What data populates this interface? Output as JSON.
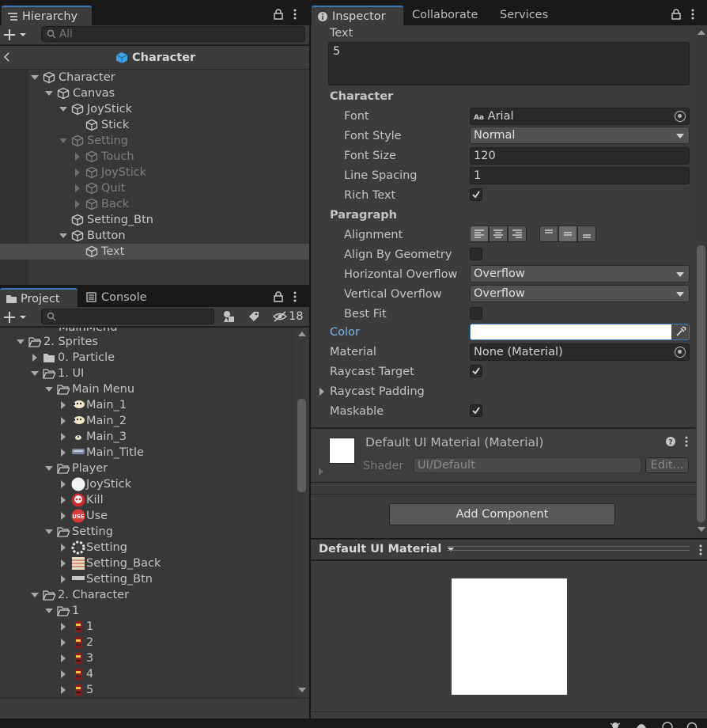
{
  "hierarchy": {
    "tab_label": "Hierarchy",
    "search_placeholder": "All",
    "scene_title": "Character",
    "rows": [
      {
        "label": "Character",
        "indent": 0,
        "arrow": "down",
        "dim": false
      },
      {
        "label": "Canvas",
        "indent": 1,
        "arrow": "down",
        "dim": false
      },
      {
        "label": "JoyStick",
        "indent": 2,
        "arrow": "down",
        "dim": false
      },
      {
        "label": "Stick",
        "indent": 3,
        "arrow": "",
        "dim": false
      },
      {
        "label": "Setting",
        "indent": 2,
        "arrow": "down",
        "dim": true
      },
      {
        "label": "Touch",
        "indent": 3,
        "arrow": "right",
        "dim": true
      },
      {
        "label": "JoyStick",
        "indent": 3,
        "arrow": "right",
        "dim": true
      },
      {
        "label": "Quit",
        "indent": 3,
        "arrow": "right",
        "dim": true
      },
      {
        "label": "Back",
        "indent": 3,
        "arrow": "right",
        "dim": true
      },
      {
        "label": "Setting_Btn",
        "indent": 2,
        "arrow": "",
        "dim": false
      },
      {
        "label": "Button",
        "indent": 2,
        "arrow": "down",
        "dim": false
      },
      {
        "label": "Text",
        "indent": 3,
        "arrow": "",
        "dim": false,
        "selected": true
      }
    ]
  },
  "project": {
    "tab_project": "Project",
    "tab_console": "Console",
    "hidden_count": "18",
    "partial_top": "MainMenu",
    "rows": [
      {
        "label": "2. Sprites",
        "indent": 0,
        "arrow": "down",
        "icon": "folder-open"
      },
      {
        "label": "0. Particle",
        "indent": 1,
        "arrow": "right",
        "icon": "folder"
      },
      {
        "label": "1. UI",
        "indent": 1,
        "arrow": "down",
        "icon": "folder-open"
      },
      {
        "label": "Main Menu",
        "indent": 2,
        "arrow": "down",
        "icon": "folder-open"
      },
      {
        "label": "Main_1",
        "indent": 3,
        "arrow": "right",
        "icon": "sprite-face"
      },
      {
        "label": "Main_2",
        "indent": 3,
        "arrow": "right",
        "icon": "sprite-face"
      },
      {
        "label": "Main_3",
        "indent": 3,
        "arrow": "right",
        "icon": "sprite-small"
      },
      {
        "label": "Main_Title",
        "indent": 3,
        "arrow": "right",
        "icon": "sprite-title"
      },
      {
        "label": "Player",
        "indent": 2,
        "arrow": "down",
        "icon": "folder-open"
      },
      {
        "label": "JoyStick",
        "indent": 3,
        "arrow": "right",
        "icon": "sprite-circle"
      },
      {
        "label": "Kill",
        "indent": 3,
        "arrow": "right",
        "icon": "sprite-skull"
      },
      {
        "label": "Use",
        "indent": 3,
        "arrow": "right",
        "icon": "sprite-use"
      },
      {
        "label": "Setting",
        "indent": 2,
        "arrow": "down",
        "icon": "folder-open"
      },
      {
        "label": "Setting",
        "indent": 3,
        "arrow": "right",
        "icon": "sprite-gear"
      },
      {
        "label": "Setting_Back",
        "indent": 3,
        "arrow": "right",
        "icon": "sprite-back"
      },
      {
        "label": "Setting_Btn",
        "indent": 3,
        "arrow": "right",
        "icon": "sprite-btn"
      },
      {
        "label": "2. Character",
        "indent": 1,
        "arrow": "down",
        "icon": "folder-open"
      },
      {
        "label": "1",
        "indent": 2,
        "arrow": "down",
        "icon": "folder-open"
      },
      {
        "label": "1",
        "indent": 3,
        "arrow": "right",
        "icon": "sprite-char"
      },
      {
        "label": "2",
        "indent": 3,
        "arrow": "right",
        "icon": "sprite-char"
      },
      {
        "label": "3",
        "indent": 3,
        "arrow": "right",
        "icon": "sprite-char"
      },
      {
        "label": "4",
        "indent": 3,
        "arrow": "right",
        "icon": "sprite-char"
      },
      {
        "label": "5",
        "indent": 3,
        "arrow": "right",
        "icon": "sprite-char"
      }
    ]
  },
  "inspector": {
    "tab_inspector": "Inspector",
    "tab_collaborate": "Collaborate",
    "tab_services": "Services",
    "text_label": "Text",
    "text_value": "5",
    "character_header": "Character",
    "font_label": "Font",
    "font_value": "Arial",
    "font_icon_text": "Aa",
    "font_style_label": "Font Style",
    "font_style_value": "Normal",
    "font_size_label": "Font Size",
    "font_size_value": "120",
    "line_spacing_label": "Line Spacing",
    "line_spacing_value": "1",
    "rich_text_label": "Rich Text",
    "rich_text_checked": true,
    "paragraph_header": "Paragraph",
    "alignment_label": "Alignment",
    "align_geometry_label": "Align By Geometry",
    "h_overflow_label": "Horizontal Overflow",
    "h_overflow_value": "Overflow",
    "v_overflow_label": "Vertical Overflow",
    "v_overflow_value": "Overflow",
    "best_fit_label": "Best Fit",
    "color_label": "Color",
    "color_value": "#ffffff",
    "material_label": "Material",
    "material_value": "None (Material)",
    "raycast_target_label": "Raycast Target",
    "raycast_padding_label": "Raycast Padding",
    "maskable_label": "Maskable",
    "material_title": "Default UI Material (Material)",
    "shader_label": "Shader",
    "shader_value": "UI/Default",
    "edit_button": "Edit...",
    "add_component": "Add Component",
    "preview_title": "Default UI Material",
    "accent": "#3a79bb",
    "color_label_color": "#7fb2e5"
  }
}
